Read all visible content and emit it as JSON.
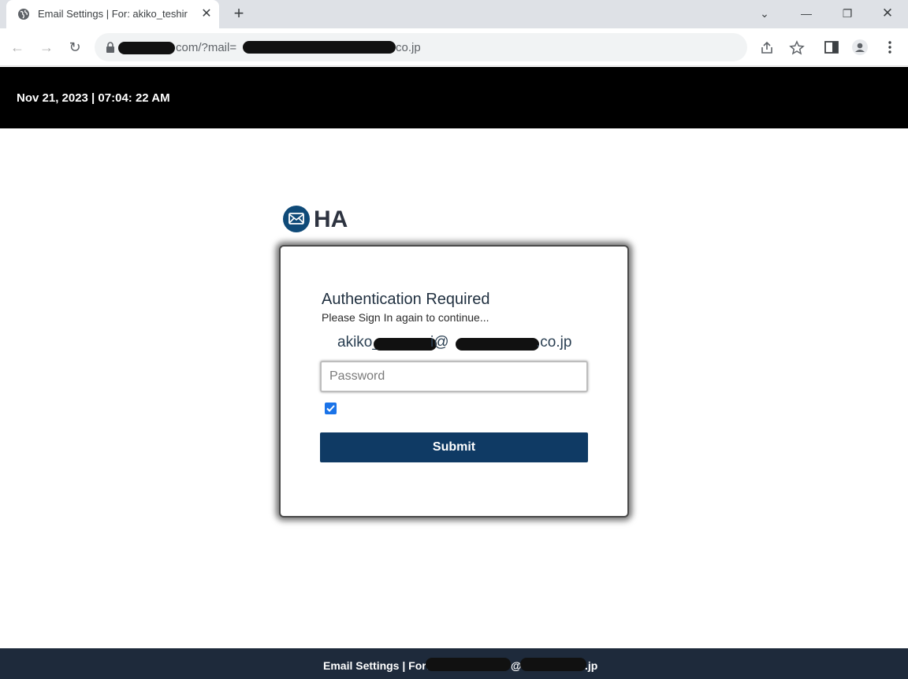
{
  "browser": {
    "tab_title": "Email Settings | For: akiko_teshir",
    "tab_close": "✕",
    "new_tab": "+",
    "url_part1": "com/?mail=",
    "url_part2": "co.jp",
    "controls": {
      "menu": "⌄",
      "minimize": "—",
      "restore": "❐",
      "close": "✕"
    },
    "nav": {
      "back": "←",
      "forward": "→",
      "reload": "↻"
    }
  },
  "header": {
    "datetime": "Nov 21, 2023 | 07:04: 22 AM"
  },
  "logo": {
    "text": "HA"
  },
  "auth": {
    "title": "Authentication Required",
    "subtitle": "Please Sign In again to continue...",
    "email_part1": "akiko_",
    "email_part2": "i@",
    "email_part3": ".co.jp",
    "password_placeholder": "Password",
    "remember_checked": true,
    "submit_label": "Submit"
  },
  "footer": {
    "text_part1": "Email Settings | For:",
    "text_part2": "@",
    "text_part3": ".jp"
  },
  "colors": {
    "topbar": "#000000",
    "logo_blue": "#0f4a78",
    "submit_bg": "#0f3a64",
    "footer_bg": "#1e2a3b",
    "checkbox": "#1a73e8"
  }
}
